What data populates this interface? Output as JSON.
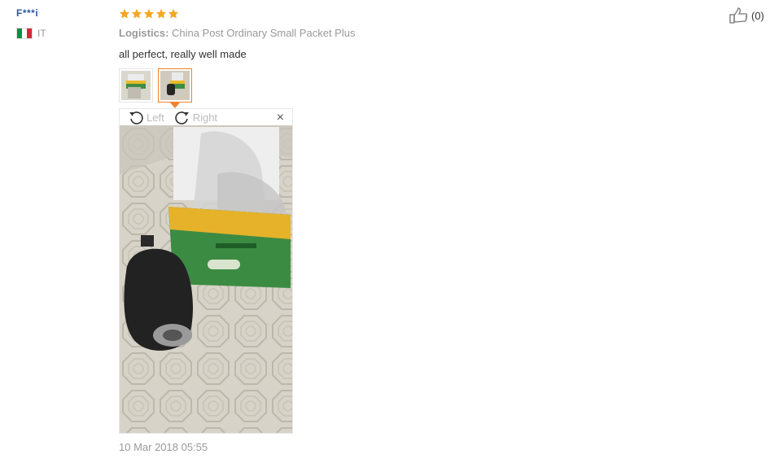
{
  "reviewer": {
    "name": "F***i",
    "country_code": "IT",
    "flag_colors": [
      "#009246",
      "#ffffff",
      "#ce2b37"
    ]
  },
  "review": {
    "rating": 5,
    "star_color": "#f5a623",
    "logistics_label": "Logistics:",
    "logistics_value": "China Post Ordinary Small Packet Plus",
    "text": "all perfect, really well made",
    "date": "10 Mar 2018 05:55"
  },
  "viewer": {
    "rotate_left_label": "Left",
    "rotate_right_label": "Right",
    "close_icon": "×"
  },
  "helpful": {
    "count_text": "(0)",
    "icon": "thumbs-up-icon"
  },
  "colors": {
    "accent": "#f0822d",
    "name_link": "#2c5a9c",
    "muted": "#999999"
  }
}
